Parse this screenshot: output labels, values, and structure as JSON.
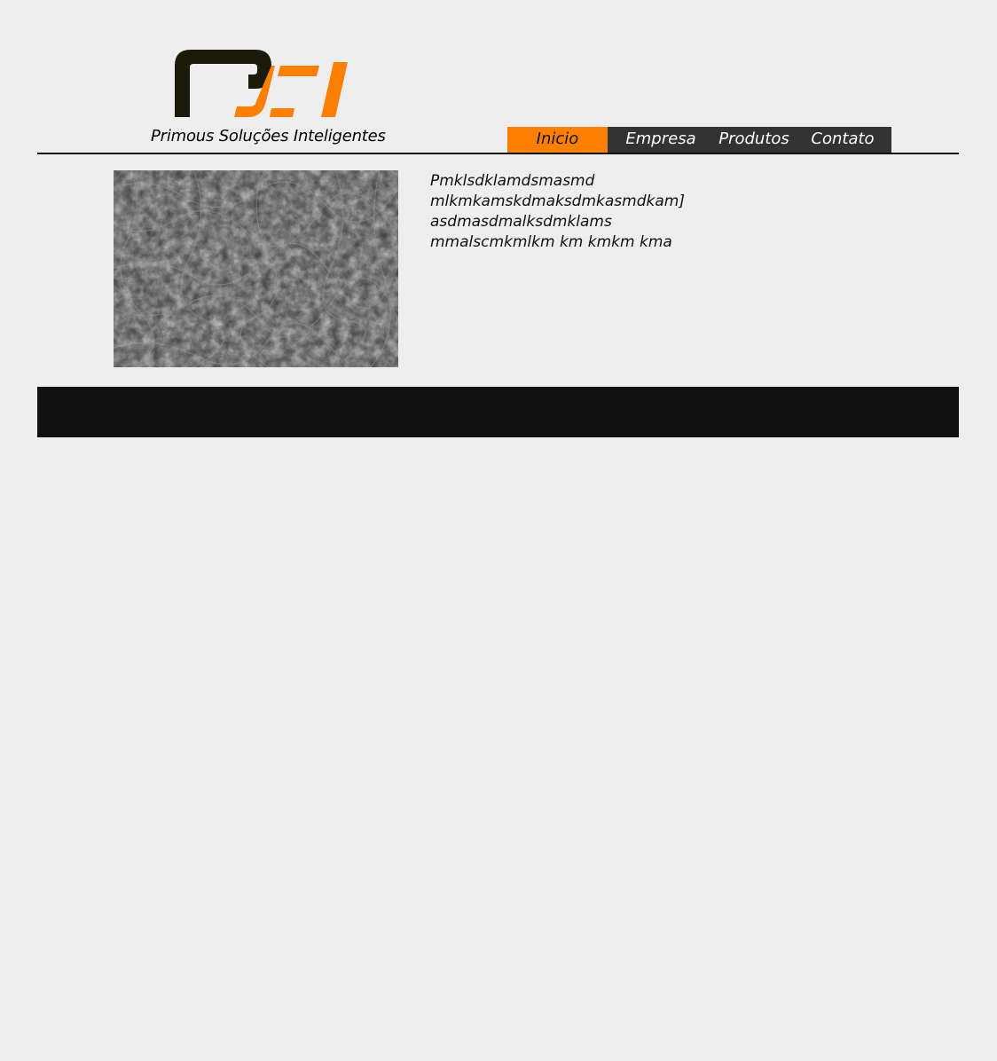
{
  "header": {
    "logo_text": "PSI",
    "tagline": "Primous Soluções Inteligentes"
  },
  "nav": {
    "items": [
      {
        "label": "Inicio",
        "active": true
      },
      {
        "label": "Empresa",
        "active": false
      },
      {
        "label": "Produtos",
        "active": false
      },
      {
        "label": "Contato",
        "active": false
      }
    ]
  },
  "main": {
    "image_icon": "texture-image",
    "paragraph_lines": [
      "Pmklsdklamdsmasmd",
      "mlkmkamskdmaksdmkasmdkam]",
      "asdmasdmalksdmklams",
      "mmalscmkmlkm km kmkm kma"
    ]
  },
  "colors": {
    "background": "#eeeeee",
    "accent": "#ff8000",
    "nav_bg": "#333333",
    "logo_dark": "#1a1a0a",
    "footer": "#111111"
  }
}
